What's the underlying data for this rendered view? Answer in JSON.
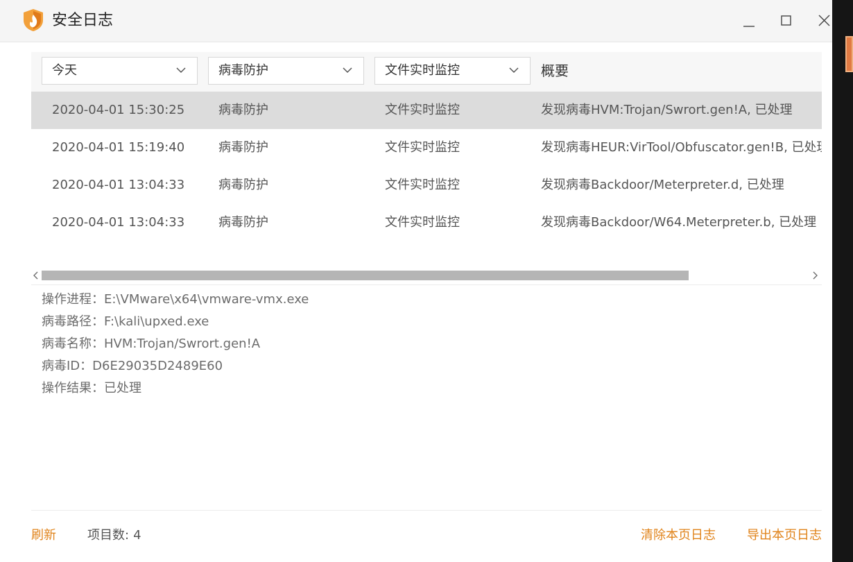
{
  "window": {
    "title": "安全日志",
    "accent_color": "#e0831a"
  },
  "filters": {
    "date": "今天",
    "category": "病毒防护",
    "source": "文件实时监控",
    "summary_header": "概要"
  },
  "rows": [
    {
      "time": "2020-04-01 15:30:25",
      "category": "病毒防护",
      "source": "文件实时监控",
      "summary": "发现病毒HVM:Trojan/Swrort.gen!A, 已处理",
      "selected": true
    },
    {
      "time": "2020-04-01 15:19:40",
      "category": "病毒防护",
      "source": "文件实时监控",
      "summary": "发现病毒HEUR:VirTool/Obfuscator.gen!B, 已处理"
    },
    {
      "time": "2020-04-01 13:04:33",
      "category": "病毒防护",
      "source": "文件实时监控",
      "summary": "发现病毒Backdoor/Meterpreter.d, 已处理"
    },
    {
      "time": "2020-04-01 13:04:33",
      "category": "病毒防护",
      "source": "文件实时监控",
      "summary": "发现病毒Backdoor/W64.Meterpreter.b, 已处理"
    }
  ],
  "details": [
    "操作进程：E:\\VMware\\x64\\vmware-vmx.exe",
    "病毒路径：F:\\kali\\upxed.exe",
    "病毒名称：HVM:Trojan/Swrort.gen!A",
    "病毒ID：D6E29035D2489E60",
    "操作结果：已处理"
  ],
  "footer": {
    "refresh": "刷新",
    "item_count_label": "项目数:",
    "item_count": "4",
    "clear_page": "清除本页日志",
    "export_page": "导出本页日志"
  },
  "icons": {
    "logo": "flame-shield-icon",
    "minimize": "minimize-icon",
    "maximize": "maximize-icon",
    "close": "close-icon",
    "dropdown": "chevron-down-icon",
    "scroll_left": "chevron-left-icon",
    "scroll_right": "chevron-right-icon"
  }
}
